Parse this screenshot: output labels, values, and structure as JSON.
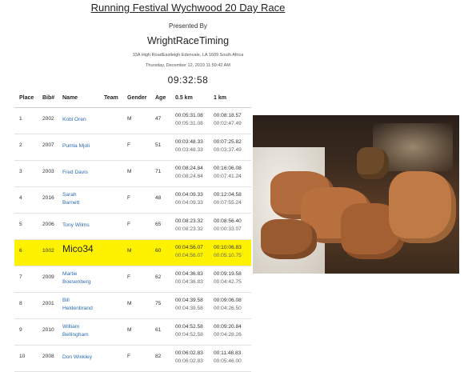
{
  "header": {
    "title": "Running Festival Wychwood 20 Day Race",
    "presented_by": "Presented By",
    "organizer": "WrightRaceTiming",
    "address": "33A High RoadEastleigh Edenvale, LA 1609 South Africa",
    "datetime": "Thursday, December 12, 2019 11:59:42 AM",
    "clock": "09:32:58"
  },
  "table": {
    "columns": [
      "Place",
      "Bib#",
      "Name",
      "Team",
      "Gender",
      "Age",
      "0.5 km",
      "1 km"
    ],
    "rows": [
      {
        "place": "1",
        "bib": "2002",
        "name": "Kobi Oren",
        "name2": "",
        "team": "",
        "gender": "M",
        "age": "47",
        "t1a": "00:05:31.08",
        "t1b": "00:05:31.08",
        "t2a": "00:08:18.57",
        "t2b": "00:02:47.49"
      },
      {
        "place": "2",
        "bib": "2007",
        "name": "Pumla Mjoli",
        "name2": "",
        "team": "",
        "gender": "F",
        "age": "51",
        "t1a": "00:03:48.33",
        "t1b": "00:03:48.33",
        "t2a": "00:07:25.82",
        "t2b": "00:03:37.49"
      },
      {
        "place": "3",
        "bib": "2003",
        "name": "Fred Davis",
        "name2": "",
        "team": "",
        "gender": "M",
        "age": "71",
        "t1a": "00:08:24.84",
        "t1b": "00:08:24.84",
        "t2a": "00:16:06.08",
        "t2b": "00:07:41.24"
      },
      {
        "place": "4",
        "bib": "2016",
        "name": "Sarah",
        "name2": "Barnett",
        "team": "",
        "gender": "F",
        "age": "48",
        "t1a": "00:04:09.33",
        "t1b": "00:04:09.33",
        "t2a": "00:12:04.58",
        "t2b": "00:07:55.24"
      },
      {
        "place": "5",
        "bib": "2006",
        "name": "Tony Wilms",
        "name2": "",
        "team": "",
        "gender": "F",
        "age": "65",
        "t1a": "00:08:23.32",
        "t1b": "00:08:23.32",
        "t2a": "00:08:56.40",
        "t2b": "00:00:33.07"
      },
      {
        "place": "6",
        "bib": "1002",
        "name": "Mico34",
        "name2": "",
        "team": "",
        "gender": "M",
        "age": "60",
        "t1a": "00:04:56.07",
        "t1b": "00:04:56.07",
        "t2a": "00:10:06.83",
        "t2b": "00:05:10.75"
      },
      {
        "place": "7",
        "bib": "2009",
        "name": "Martie",
        "name2": "Boesenberg",
        "team": "",
        "gender": "F",
        "age": "62",
        "t1a": "00:04:36.83",
        "t1b": "00:04:36.83",
        "t2a": "00:09:19.58",
        "t2b": "00:04:42.75"
      },
      {
        "place": "8",
        "bib": "2001",
        "name": "Bill",
        "name2": "Heldenbrand",
        "team": "",
        "gender": "M",
        "age": "75",
        "t1a": "00:04:39.58",
        "t1b": "00:04:39.58",
        "t2a": "00:09:06.08",
        "t2b": "00:04:26.50"
      },
      {
        "place": "9",
        "bib": "2010",
        "name": "William",
        "name2": "Bellingham",
        "team": "",
        "gender": "M",
        "age": "61",
        "t1a": "00:04:52.58",
        "t1b": "00:04:52.58",
        "t2a": "00:09:20.84",
        "t2b": "00:04:28.26"
      },
      {
        "place": "10",
        "bib": "2008",
        "name": "Don Winkley",
        "name2": "",
        "team": "",
        "gender": "F",
        "age": "82",
        "t1a": "00:06:02.83",
        "t1b": "00:06:02.83",
        "t2a": "00:11:48.83",
        "t2b": "00:05:46.00"
      }
    ]
  },
  "colors": {
    "highlight": "#fff200",
    "link": "#2b6cb0"
  },
  "photo": {
    "icon": "trophies-photo"
  }
}
